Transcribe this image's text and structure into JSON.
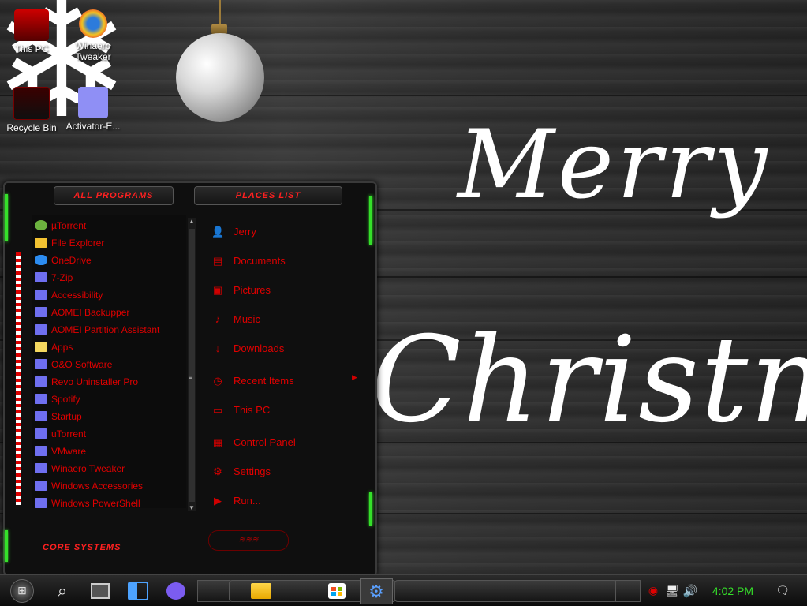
{
  "desktop": {
    "greeting_line1": "Merry",
    "greeting_line2": "Christmas",
    "icons": [
      {
        "label": "This PC",
        "icon": "monitor-icon"
      },
      {
        "label": "Winaero Tweaker",
        "icon": "winaero-icon"
      },
      {
        "label": "Recycle Bin",
        "icon": "recycle-bin-icon"
      },
      {
        "label": "Activator-E...",
        "icon": "file-icon"
      }
    ]
  },
  "start_menu": {
    "all_programs_label": "ALL PROGRAMS",
    "places_list_label": "PLACES LIST",
    "footer_label": "CORE SYSTEMS",
    "programs": [
      {
        "label": "µTorrent",
        "icon": "utorrent-icon"
      },
      {
        "label": "File Explorer",
        "icon": "file-explorer-icon"
      },
      {
        "label": "OneDrive",
        "icon": "onedrive-icon"
      },
      {
        "label": "7-Zip",
        "icon": "folder-icon"
      },
      {
        "label": "Accessibility",
        "icon": "folder-icon"
      },
      {
        "label": "AOMEI Backupper",
        "icon": "folder-icon"
      },
      {
        "label": "AOMEI Partition Assistant",
        "icon": "folder-icon"
      },
      {
        "label": "Apps",
        "icon": "apps-icon"
      },
      {
        "label": "O&O Software",
        "icon": "folder-icon"
      },
      {
        "label": "Revo Uninstaller Pro",
        "icon": "folder-icon"
      },
      {
        "label": "Spotify",
        "icon": "folder-icon"
      },
      {
        "label": "Startup",
        "icon": "folder-icon"
      },
      {
        "label": "uTorrent",
        "icon": "folder-icon"
      },
      {
        "label": "VMware",
        "icon": "folder-icon"
      },
      {
        "label": "Winaero Tweaker",
        "icon": "folder-icon"
      },
      {
        "label": "Windows Accessories",
        "icon": "folder-icon"
      },
      {
        "label": "Windows PowerShell",
        "icon": "folder-icon"
      }
    ],
    "places": [
      {
        "label": "Jerry",
        "icon": "user-icon"
      },
      {
        "label": "Documents",
        "icon": "document-icon"
      },
      {
        "label": "Pictures",
        "icon": "picture-icon"
      },
      {
        "label": "Music",
        "icon": "music-icon"
      },
      {
        "label": "Downloads",
        "icon": "download-icon"
      },
      {
        "label": "Recent Items",
        "icon": "clock-icon"
      },
      {
        "label": "This PC",
        "icon": "computer-icon"
      },
      {
        "label": "Control Panel",
        "icon": "control-panel-icon"
      },
      {
        "label": "Settings",
        "icon": "gear-icon"
      },
      {
        "label": "Run...",
        "icon": "run-icon"
      }
    ]
  },
  "taskbar": {
    "clock": "4:02 PM"
  },
  "colors": {
    "menu_text": "#e00000",
    "accent_green": "#35e02a",
    "folder": "#6f6ff0"
  }
}
